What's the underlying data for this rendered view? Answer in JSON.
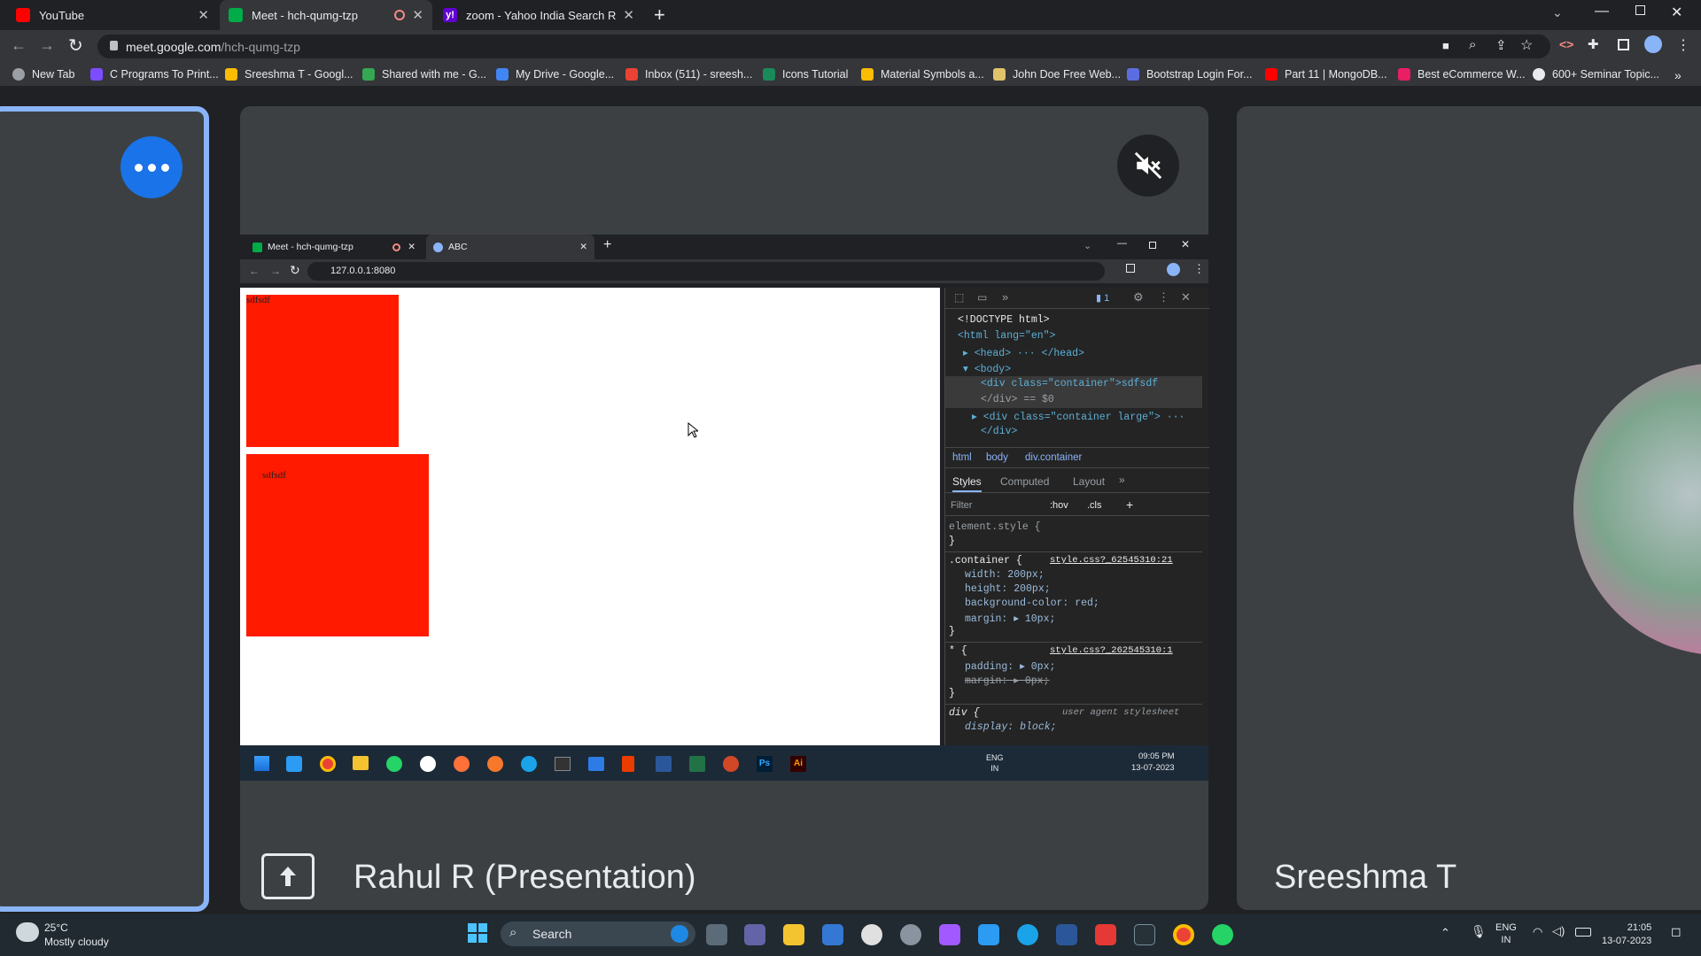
{
  "browser": {
    "tabs": [
      {
        "title": "YouTube"
      },
      {
        "title": "Meet - hch-qumg-tzp"
      },
      {
        "title": "zoom - Yahoo India Search Resul"
      }
    ],
    "url_domain": "meet.google.com",
    "url_path": "/hch-qumg-tzp",
    "bookmarks": [
      "New Tab",
      "C Programs To Print...",
      "Sreeshma T - Googl...",
      "Shared with me - G...",
      "My Drive - Google...",
      "Inbox (511) - sreesh...",
      "Icons Tutorial",
      "Material Symbols a...",
      "John Doe Free Web...",
      "Bootstrap Login For...",
      "Part 11 | MongoDB...",
      "Best eCommerce W...",
      "600+ Seminar Topic..."
    ]
  },
  "meet": {
    "presenter_label": "Rahul R (Presentation)",
    "participant_name": "Sreeshma T",
    "accent": "#8ab4f8"
  },
  "shared_screen": {
    "tabs": [
      {
        "title": "Meet - hch-qumg-tzp"
      },
      {
        "title": "ABC"
      }
    ],
    "url": "127.0.0.1:8080",
    "page": {
      "box1_text": "sdfsdf",
      "box2_text": "sdfsdf",
      "box_color": "#ff1a00"
    },
    "devtools": {
      "issues_count": "1",
      "dom": [
        {
          "t": "<!DOCTYPE html>"
        },
        {
          "t": "<html lang=\"en\">"
        },
        {
          "t": "<head> ··· </head>"
        },
        {
          "t": "<body>"
        },
        {
          "t": "<div class=\"container\">sdfsdf"
        },
        {
          "t": "</div> == $0"
        },
        {
          "t": "<div class=\"container large\"> ···"
        },
        {
          "t": "</div>"
        }
      ],
      "breadcrumb": [
        "html",
        "body",
        "div.container"
      ],
      "panel_tabs": [
        "Styles",
        "Computed",
        "Layout"
      ],
      "filter_placeholder": "Filter",
      "hov": ":hov",
      "cls": ".cls",
      "styles": [
        {
          "t": "element.style {"
        },
        {
          "t": "}"
        },
        {
          "t": ".container {",
          "src": "style.css?_62545310:21"
        },
        {
          "t": "width: 200px;"
        },
        {
          "t": "height: 200px;"
        },
        {
          "t": "background-color: red;"
        },
        {
          "t": "margin: ▸ 10px;"
        },
        {
          "t": "}"
        },
        {
          "t": "* {",
          "src": "style.css?_262545310:1"
        },
        {
          "t": "padding: ▸ 0px;"
        },
        {
          "t": "margin: ▸ 0px;"
        },
        {
          "t": "}"
        },
        {
          "t": "div {",
          "src": "user agent stylesheet"
        },
        {
          "t": "display: block;"
        }
      ]
    },
    "tray": {
      "lang": "ENG",
      "region": "IN",
      "time": "09:05 PM",
      "date": "13-07-2023"
    }
  },
  "taskbar": {
    "weather_temp": "25°C",
    "weather_desc": "Mostly cloudy",
    "search_label": "Search",
    "lang": "ENG",
    "region": "IN",
    "time": "21:05",
    "date": "13-07-2023"
  }
}
